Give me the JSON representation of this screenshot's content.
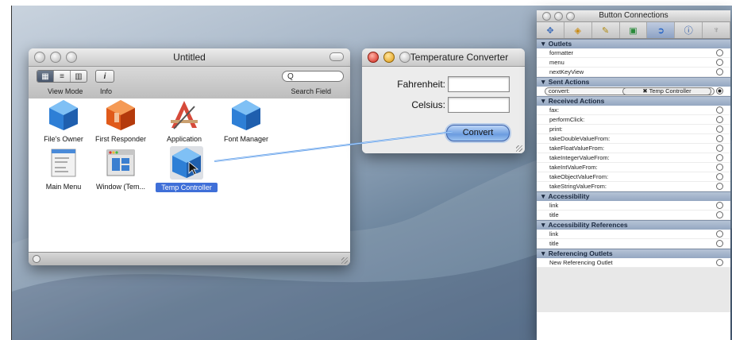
{
  "colors": {
    "accent": "#3f6fd8",
    "button_blue": "#6c9de0",
    "section_header": "#a4b4ca"
  },
  "doc_window": {
    "title": "Untitled",
    "toolbar": {
      "view_mode_label": "View Mode",
      "info_label": "Info",
      "search_label": "Search Field",
      "search_glyph": "Q"
    },
    "items": [
      {
        "label": "File's Owner",
        "icon": "blue-cube-icon"
      },
      {
        "label": "First Responder",
        "icon": "red-cube-icon"
      },
      {
        "label": "Application",
        "icon": "application-icon"
      },
      {
        "label": "Font Manager",
        "icon": "blue-cube-icon"
      },
      {
        "label": "Main Menu",
        "icon": "menu-icon"
      },
      {
        "label": "Window (Tem...",
        "icon": "window-icon"
      },
      {
        "label": "Temp Controller",
        "icon": "blue-cube-icon"
      }
    ]
  },
  "converter_window": {
    "title": "Temperature Converter",
    "fahrenheit_label": "Fahrenheit:",
    "celsius_label": "Celsius:",
    "convert_button": "Convert"
  },
  "inspector": {
    "title": "Button Connections",
    "tabs": [
      "attributes-icon",
      "effects-icon",
      "size-icon",
      "bindings-icon",
      "connections-icon",
      "info-icon",
      "identity-icon"
    ],
    "sections": [
      {
        "title": "Outlets",
        "rows": [
          "formatter",
          "menu",
          "nextKeyView"
        ]
      },
      {
        "title": "Sent Actions",
        "rows": []
      },
      {
        "title": "Received Actions",
        "rows": [
          "fax:",
          "performClick:",
          "print:",
          "takeDoubleValueFrom:",
          "takeFloatValueFrom:",
          "takeIntegerValueFrom:",
          "takeIntValueFrom:",
          "takeObjectValueFrom:",
          "takeStringValueFrom:"
        ]
      },
      {
        "title": "Accessibility",
        "rows": [
          "link",
          "title"
        ]
      },
      {
        "title": "Accessibility References",
        "rows": [
          "link",
          "title"
        ]
      },
      {
        "title": "Referencing Outlets",
        "rows": [
          "New Referencing Outlet"
        ]
      }
    ],
    "sent_action": {
      "action": "convert:",
      "target": "Temp Controller"
    }
  }
}
